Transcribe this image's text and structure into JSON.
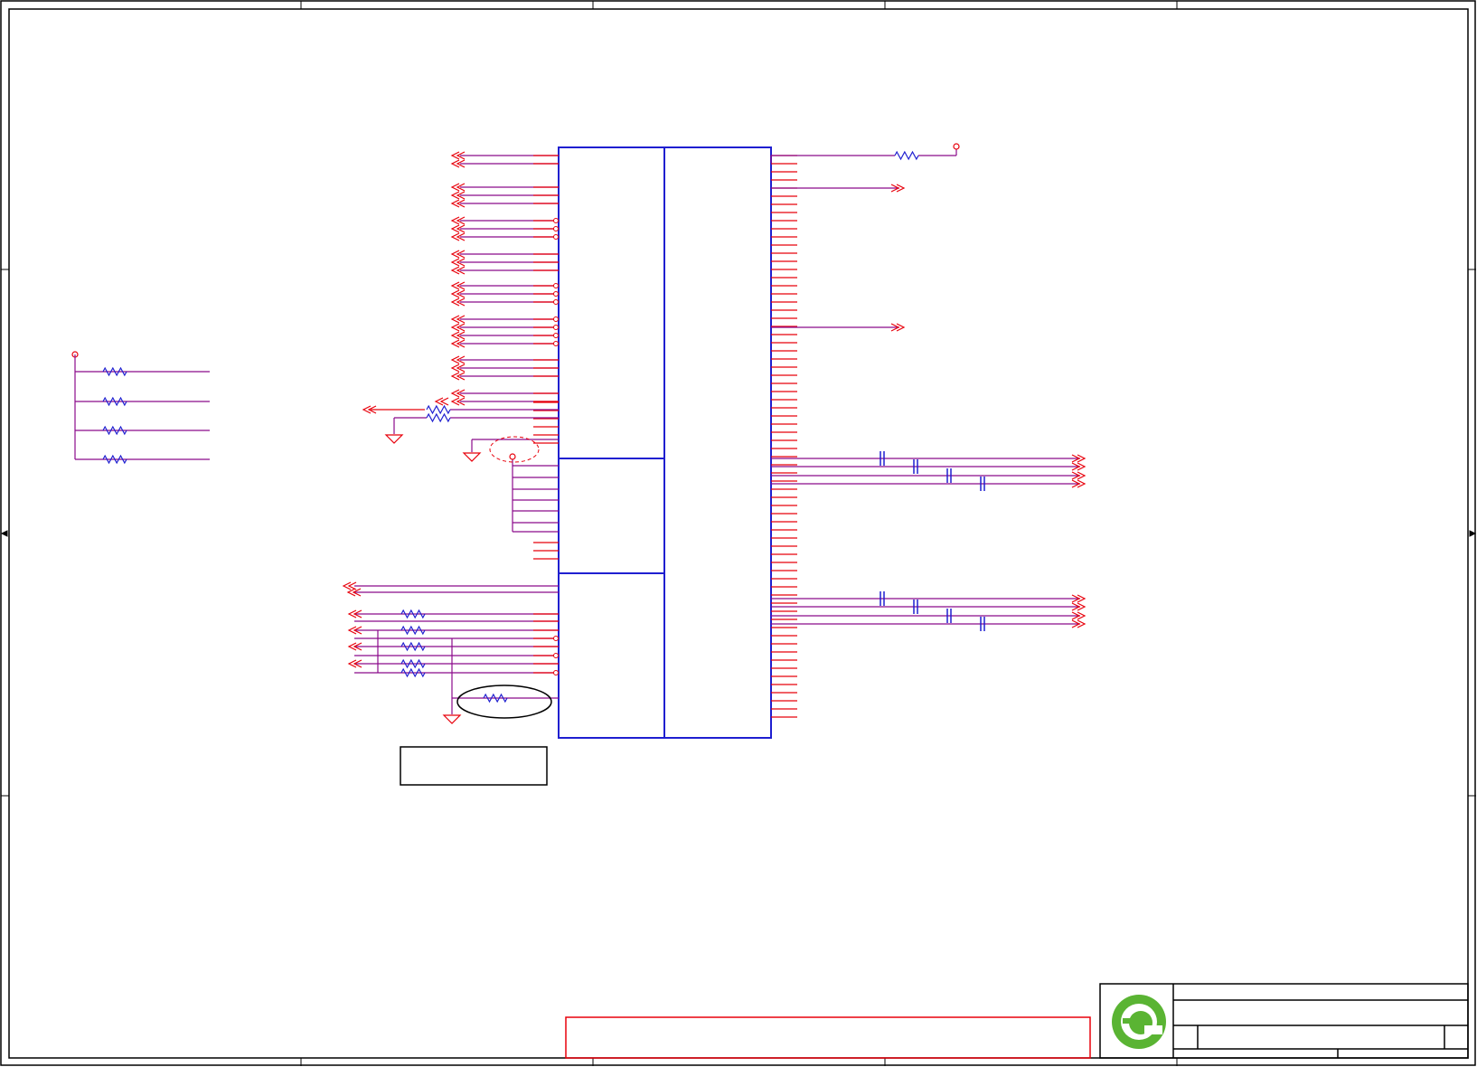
{
  "colors": {
    "wire": "#e8000b",
    "net": "#8b0a8b",
    "part": "#1f1fd0",
    "frame": "#000000",
    "logo": "#5ab433"
  },
  "sheet": {
    "has_text": false,
    "logo_icon": "green-circle-e-logo",
    "notes_box": "blank",
    "title_block": "blank"
  }
}
